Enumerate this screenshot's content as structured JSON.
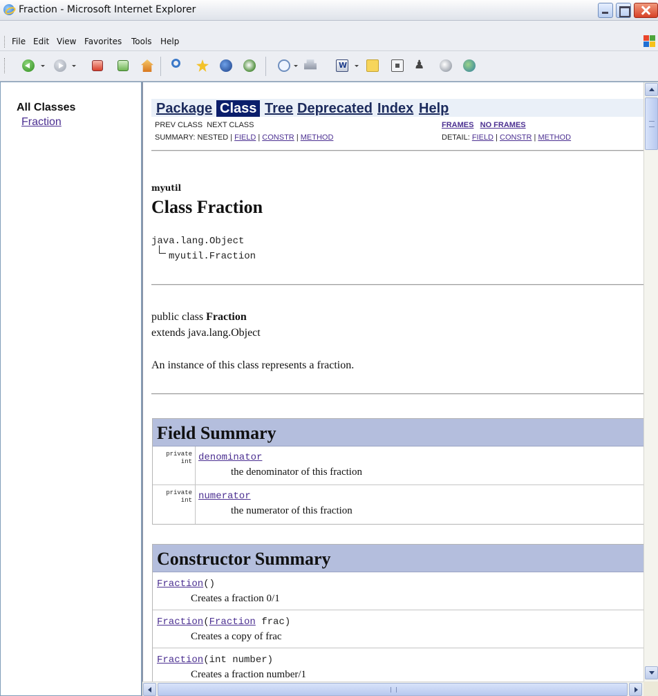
{
  "window": {
    "title": "Fraction - Microsoft Internet Explorer"
  },
  "menu": {
    "items": [
      "File",
      "Edit",
      "View",
      "Favorites",
      "Tools",
      "Help"
    ]
  },
  "toolbar": {
    "icons": [
      "back-icon",
      "forward-icon",
      "stop-icon",
      "refresh-icon",
      "home-icon",
      "search-icon",
      "favorites-icon",
      "media-icon",
      "history-icon",
      "mail-icon",
      "print-icon",
      "word-icon",
      "note-icon",
      "messenger-icon",
      "research-icon",
      "discuss-icon",
      "extra-icon"
    ]
  },
  "left_frame": {
    "heading": "All Classes",
    "classes": [
      "Fraction"
    ]
  },
  "nav": {
    "tabs": [
      "Package",
      "Class",
      "Tree",
      "Deprecated",
      "Index",
      "Help"
    ],
    "active_tab": "Class",
    "prev_class": "PREV CLASS",
    "next_class": "NEXT CLASS",
    "frames": "FRAMES",
    "no_frames": "NO FRAMES",
    "summary_label": "SUMMARY: NESTED |",
    "summary_field": "FIELD",
    "summary_constr": "CONSTR",
    "summary_method": "METHOD",
    "detail_label": "DETAIL:",
    "detail_field": "FIELD",
    "detail_constr": "CONSTR",
    "detail_method": "METHOD",
    "separator": "|"
  },
  "class_info": {
    "package": "myutil",
    "title": "Class Fraction",
    "hierarchy_root": "java.lang.Object",
    "hierarchy_child": "myutil.Fraction",
    "declaration_prefix": "public class",
    "declaration_name": "Fraction",
    "extends_line": "extends java.lang.Object",
    "description": "An instance of this class represents a fraction."
  },
  "field_summary": {
    "heading": "Field Summary",
    "rows": [
      {
        "modifier": "private",
        "type": "int",
        "name": "denominator",
        "description": "the denominator of this fraction"
      },
      {
        "modifier": "private",
        "type": "int",
        "name": "numerator",
        "description": "the numerator of this fraction"
      }
    ]
  },
  "constructor_summary": {
    "heading": "Constructor Summary",
    "rows": [
      {
        "name": "Fraction",
        "params_prefix": "()",
        "param_link": "",
        "params_suffix": "",
        "description": "Creates a fraction 0/1"
      },
      {
        "name": "Fraction",
        "params_prefix": "(",
        "param_link": "Fraction",
        "params_suffix": " frac)",
        "description": "Creates a copy of frac"
      },
      {
        "name": "Fraction",
        "params_prefix": "(int number)",
        "param_link": "",
        "params_suffix": "",
        "description": "Creates a fraction number/1"
      }
    ]
  }
}
